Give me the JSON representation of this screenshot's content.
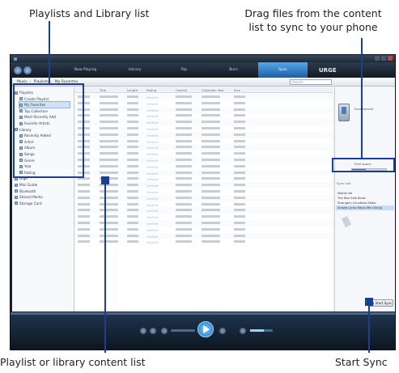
{
  "annotations": {
    "top_left": "Playlists and Library list",
    "top_right_line1": "Drag files from the content",
    "top_right_line2": "list to sync to your phone",
    "bottom_left": "Playlist or library content list",
    "bottom_right": "Start Sync"
  },
  "colors": {
    "leader_line": "#1a3f94",
    "active_tab": "#2a86d6",
    "window_frame": "#1b2330"
  },
  "player": {
    "tabs": [
      "Now Playing",
      "Library",
      "Rip",
      "Burn",
      "Sync"
    ],
    "active_tab": "Sync",
    "brand": "URGE",
    "breadcrumb": [
      "Music",
      "Playlists",
      "My Favorites"
    ],
    "search_placeholder": "Search",
    "tree_items": [
      "Playlists",
      "Create Playlist",
      "My Favorites",
      "Top Collection",
      "Most Recently Add",
      "Favorite Artists",
      "Library",
      "Recently Added",
      "Artist",
      "Album",
      "Songs",
      "Genre",
      "Year",
      "Rating",
      "Urge",
      "Mini Guide",
      "Bluetooth",
      "Shared Media",
      "Storage Card"
    ],
    "selected_tree_item": "My Favorites",
    "list_columns": [
      "Title",
      "Length",
      "Rating",
      "Contrib",
      "Collection Year",
      "Size"
    ],
    "sync_pane": {
      "device_name": "Smartphone",
      "free_space": "Free space",
      "sync_list_label": "Sync List",
      "sync_items": [
        "Mobile Vol",
        "The Real Folk Blues",
        "Strangers Countless Radio",
        "Smoke Lyrics Ratio (Mini Song)"
      ],
      "start_sync_label": "Start Sync"
    },
    "capacity_fraction": 0.4,
    "volume_fraction": 0.6
  }
}
